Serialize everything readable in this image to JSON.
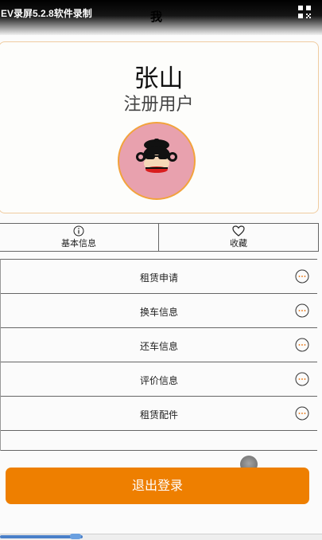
{
  "status_bar": {
    "recorder_label": "EV录屏5.2.8软件录制"
  },
  "header": {
    "title": "我"
  },
  "profile": {
    "name": "张山",
    "role": "注册用户"
  },
  "tabs": [
    {
      "label": "基本信息",
      "icon": "info-icon"
    },
    {
      "label": "收藏",
      "icon": "heart-icon"
    }
  ],
  "menu": {
    "items": [
      {
        "label": "租赁申请"
      },
      {
        "label": "换车信息"
      },
      {
        "label": "还车信息"
      },
      {
        "label": "评价信息"
      },
      {
        "label": "租赁配件"
      }
    ]
  },
  "logout": {
    "label": "退出登录"
  },
  "colors": {
    "accent": "#ee7f00",
    "avatar_bg": "#e8a1ae",
    "card_border": "#f0cca0"
  }
}
